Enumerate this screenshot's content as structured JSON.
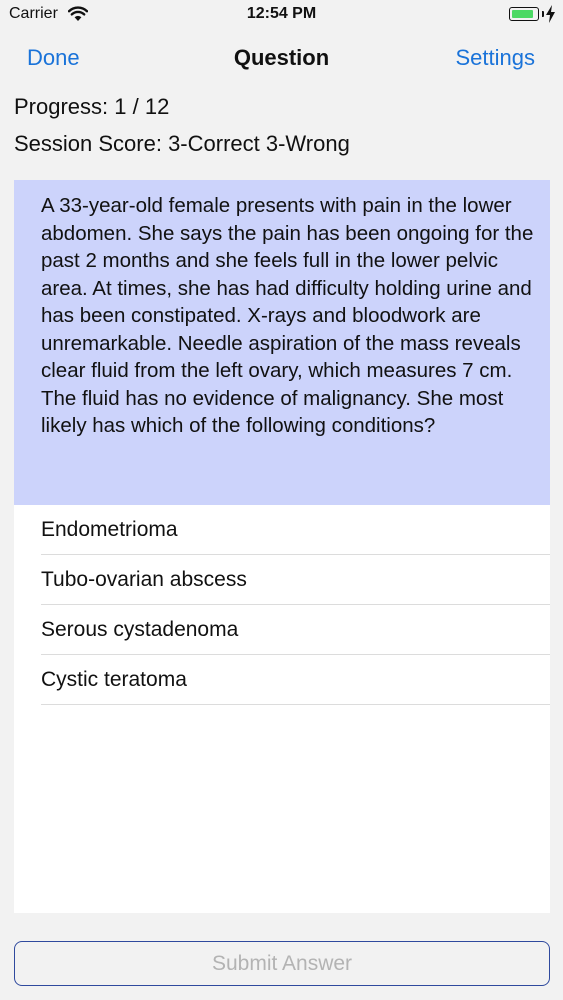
{
  "status_bar": {
    "carrier": "Carrier",
    "time": "12:54 PM",
    "battery_level": 0.9,
    "battery_color": "#4cd964"
  },
  "nav": {
    "left_button": "Done",
    "title": "Question",
    "right_button": "Settings",
    "accent_color": "#1a73d9"
  },
  "session": {
    "progress": "Progress: 1 / 12",
    "score": "Session Score: 3-Correct 3-Wrong"
  },
  "question": {
    "text": "A 33-year-old female presents with pain in the lower abdomen. She says the pain has been ongoing for the past 2 months and she feels full in the lower pelvic area. At times, she has had difficulty holding urine and has been constipated. X-rays and bloodwork are unremarkable. Needle aspiration of the mass reveals clear fluid from the left ovary, which measures 7 cm. The fluid has no evidence of malignancy. She most likely has which of the following conditions?",
    "background_color": "#ccd3fb"
  },
  "answers": [
    {
      "label": "Endometrioma"
    },
    {
      "label": "Tubo-ovarian abscess"
    },
    {
      "label": "Serous cystadenoma"
    },
    {
      "label": "Cystic teratoma"
    }
  ],
  "submit": {
    "label": "Submit Answer",
    "enabled": false
  }
}
